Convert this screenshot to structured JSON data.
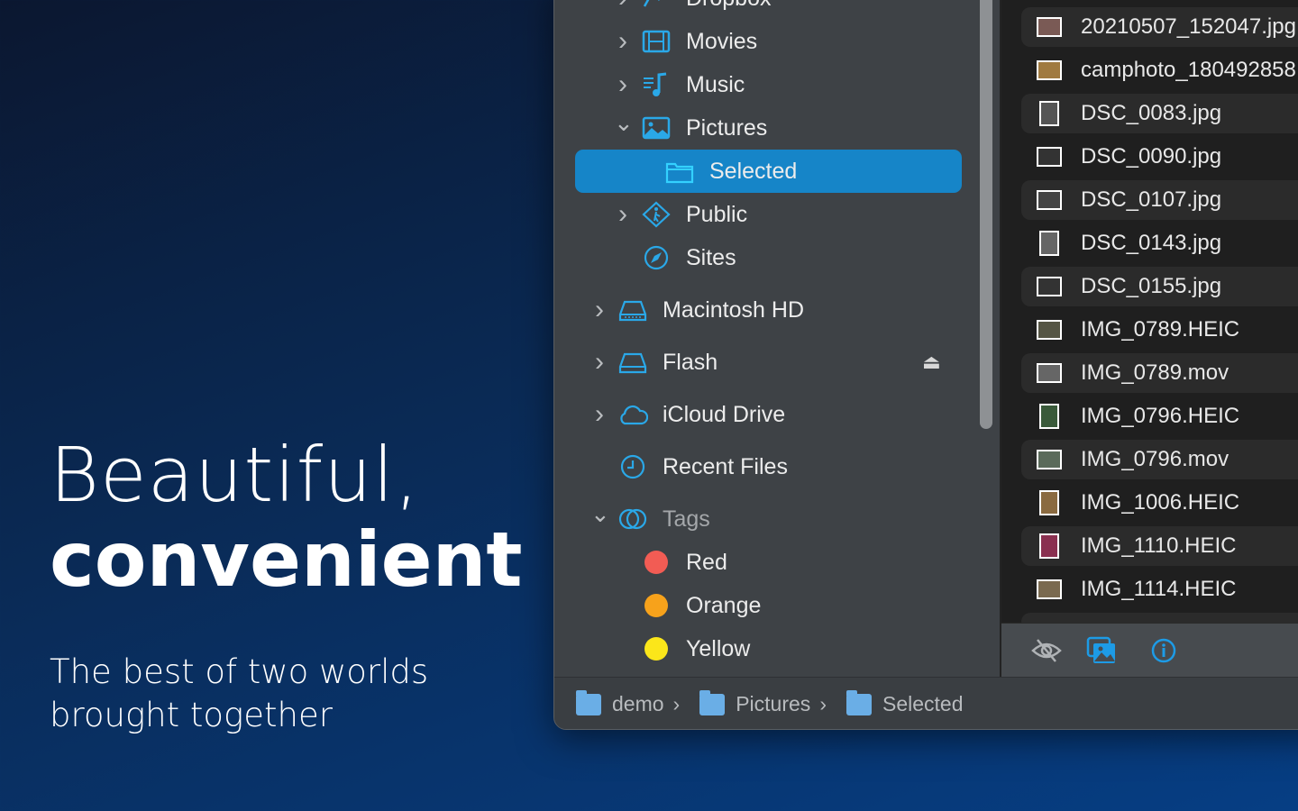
{
  "hero": {
    "line1": "Beautiful,",
    "line2": "convenient",
    "subtitle_line1": "The best of two worlds",
    "subtitle_line2": "brought together"
  },
  "sidebar": {
    "items": [
      {
        "label": "Dropbox",
        "icon": "dropbox-icon",
        "chevron": "right"
      },
      {
        "label": "Movies",
        "icon": "film-icon",
        "chevron": "right"
      },
      {
        "label": "Music",
        "icon": "music-icon",
        "chevron": "right"
      },
      {
        "label": "Pictures",
        "icon": "photo-icon",
        "chevron": "down"
      },
      {
        "label": "Selected",
        "icon": "folder-icon",
        "selected": true
      },
      {
        "label": "Public",
        "icon": "public-icon",
        "chevron": "right"
      },
      {
        "label": "Sites",
        "icon": "compass-icon"
      },
      {
        "label": "Macintosh HD",
        "icon": "internal-drive-icon",
        "chevron": "right"
      },
      {
        "label": "Flash",
        "icon": "external-drive-icon",
        "chevron": "right",
        "eject": true
      },
      {
        "label": "iCloud Drive",
        "icon": "cloud-icon",
        "chevron": "right"
      },
      {
        "label": "Recent Files",
        "icon": "clock-icon"
      },
      {
        "label": "Tags",
        "icon": "tags-icon",
        "chevron": "down"
      },
      {
        "label": "Red",
        "color": "#f25c54"
      },
      {
        "label": "Orange",
        "color": "#f7a21b"
      },
      {
        "label": "Yellow",
        "color": "#fbe61a"
      }
    ]
  },
  "files": [
    "20210507_152047.jpg",
    "camphoto_180492858",
    "DSC_0083.jpg",
    "DSC_0090.jpg",
    "DSC_0107.jpg",
    "DSC_0143.jpg",
    "DSC_0155.jpg",
    "IMG_0789.HEIC",
    "IMG_0789.mov",
    "IMG_0796.HEIC",
    "IMG_0796.mov",
    "IMG_1006.HEIC",
    "IMG_1110.HEIC",
    "IMG_1114.HEIC"
  ],
  "pathbar": [
    "demo",
    "Pictures",
    "Selected"
  ],
  "colors": {
    "accent": "#1685c8",
    "icon": "#2aa8e8"
  }
}
